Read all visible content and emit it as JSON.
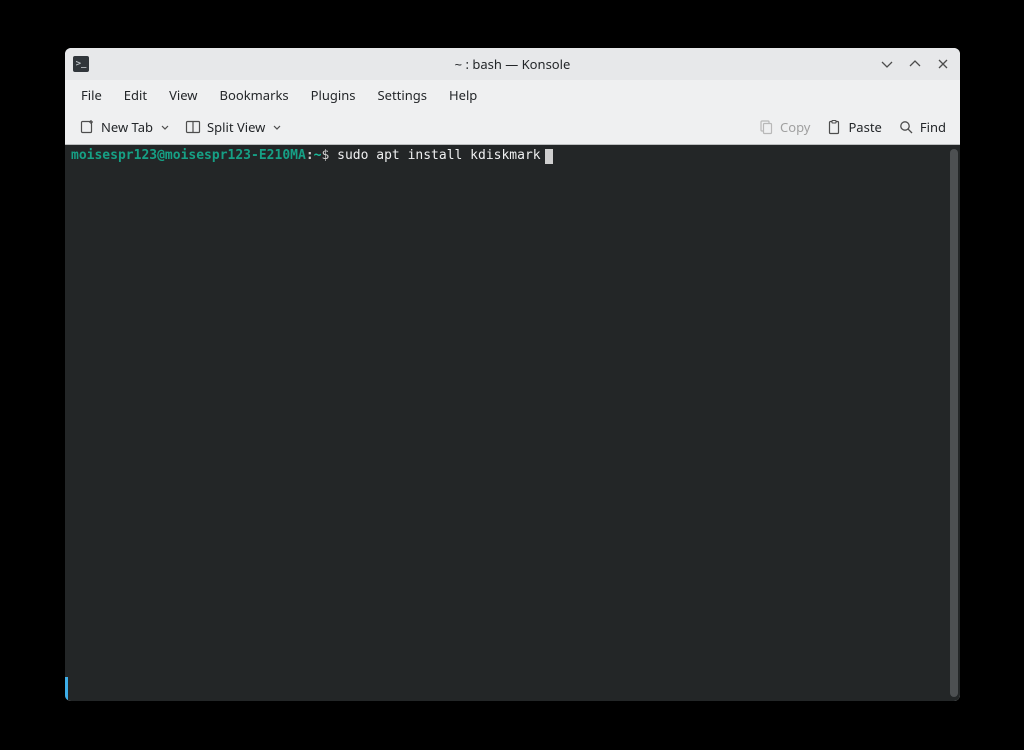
{
  "window": {
    "title": "~ : bash — Konsole"
  },
  "menubar": {
    "file": "File",
    "edit": "Edit",
    "view": "View",
    "bookmarks": "Bookmarks",
    "plugins": "Plugins",
    "settings": "Settings",
    "help": "Help"
  },
  "toolbar": {
    "new_tab": "New Tab",
    "split_view": "Split View",
    "copy": "Copy",
    "paste": "Paste",
    "find": "Find"
  },
  "terminal": {
    "prompt_user": "moisespr123@moisespr123-E210MA",
    "prompt_sep": ":",
    "prompt_path": "~",
    "prompt_dollar": "$ ",
    "command": "sudo apt install kdiskmark"
  },
  "colors": {
    "accent": "#3daee9",
    "prompt_green": "#16a085",
    "terminal_bg": "#232627",
    "chrome_bg": "#eff0f1"
  }
}
